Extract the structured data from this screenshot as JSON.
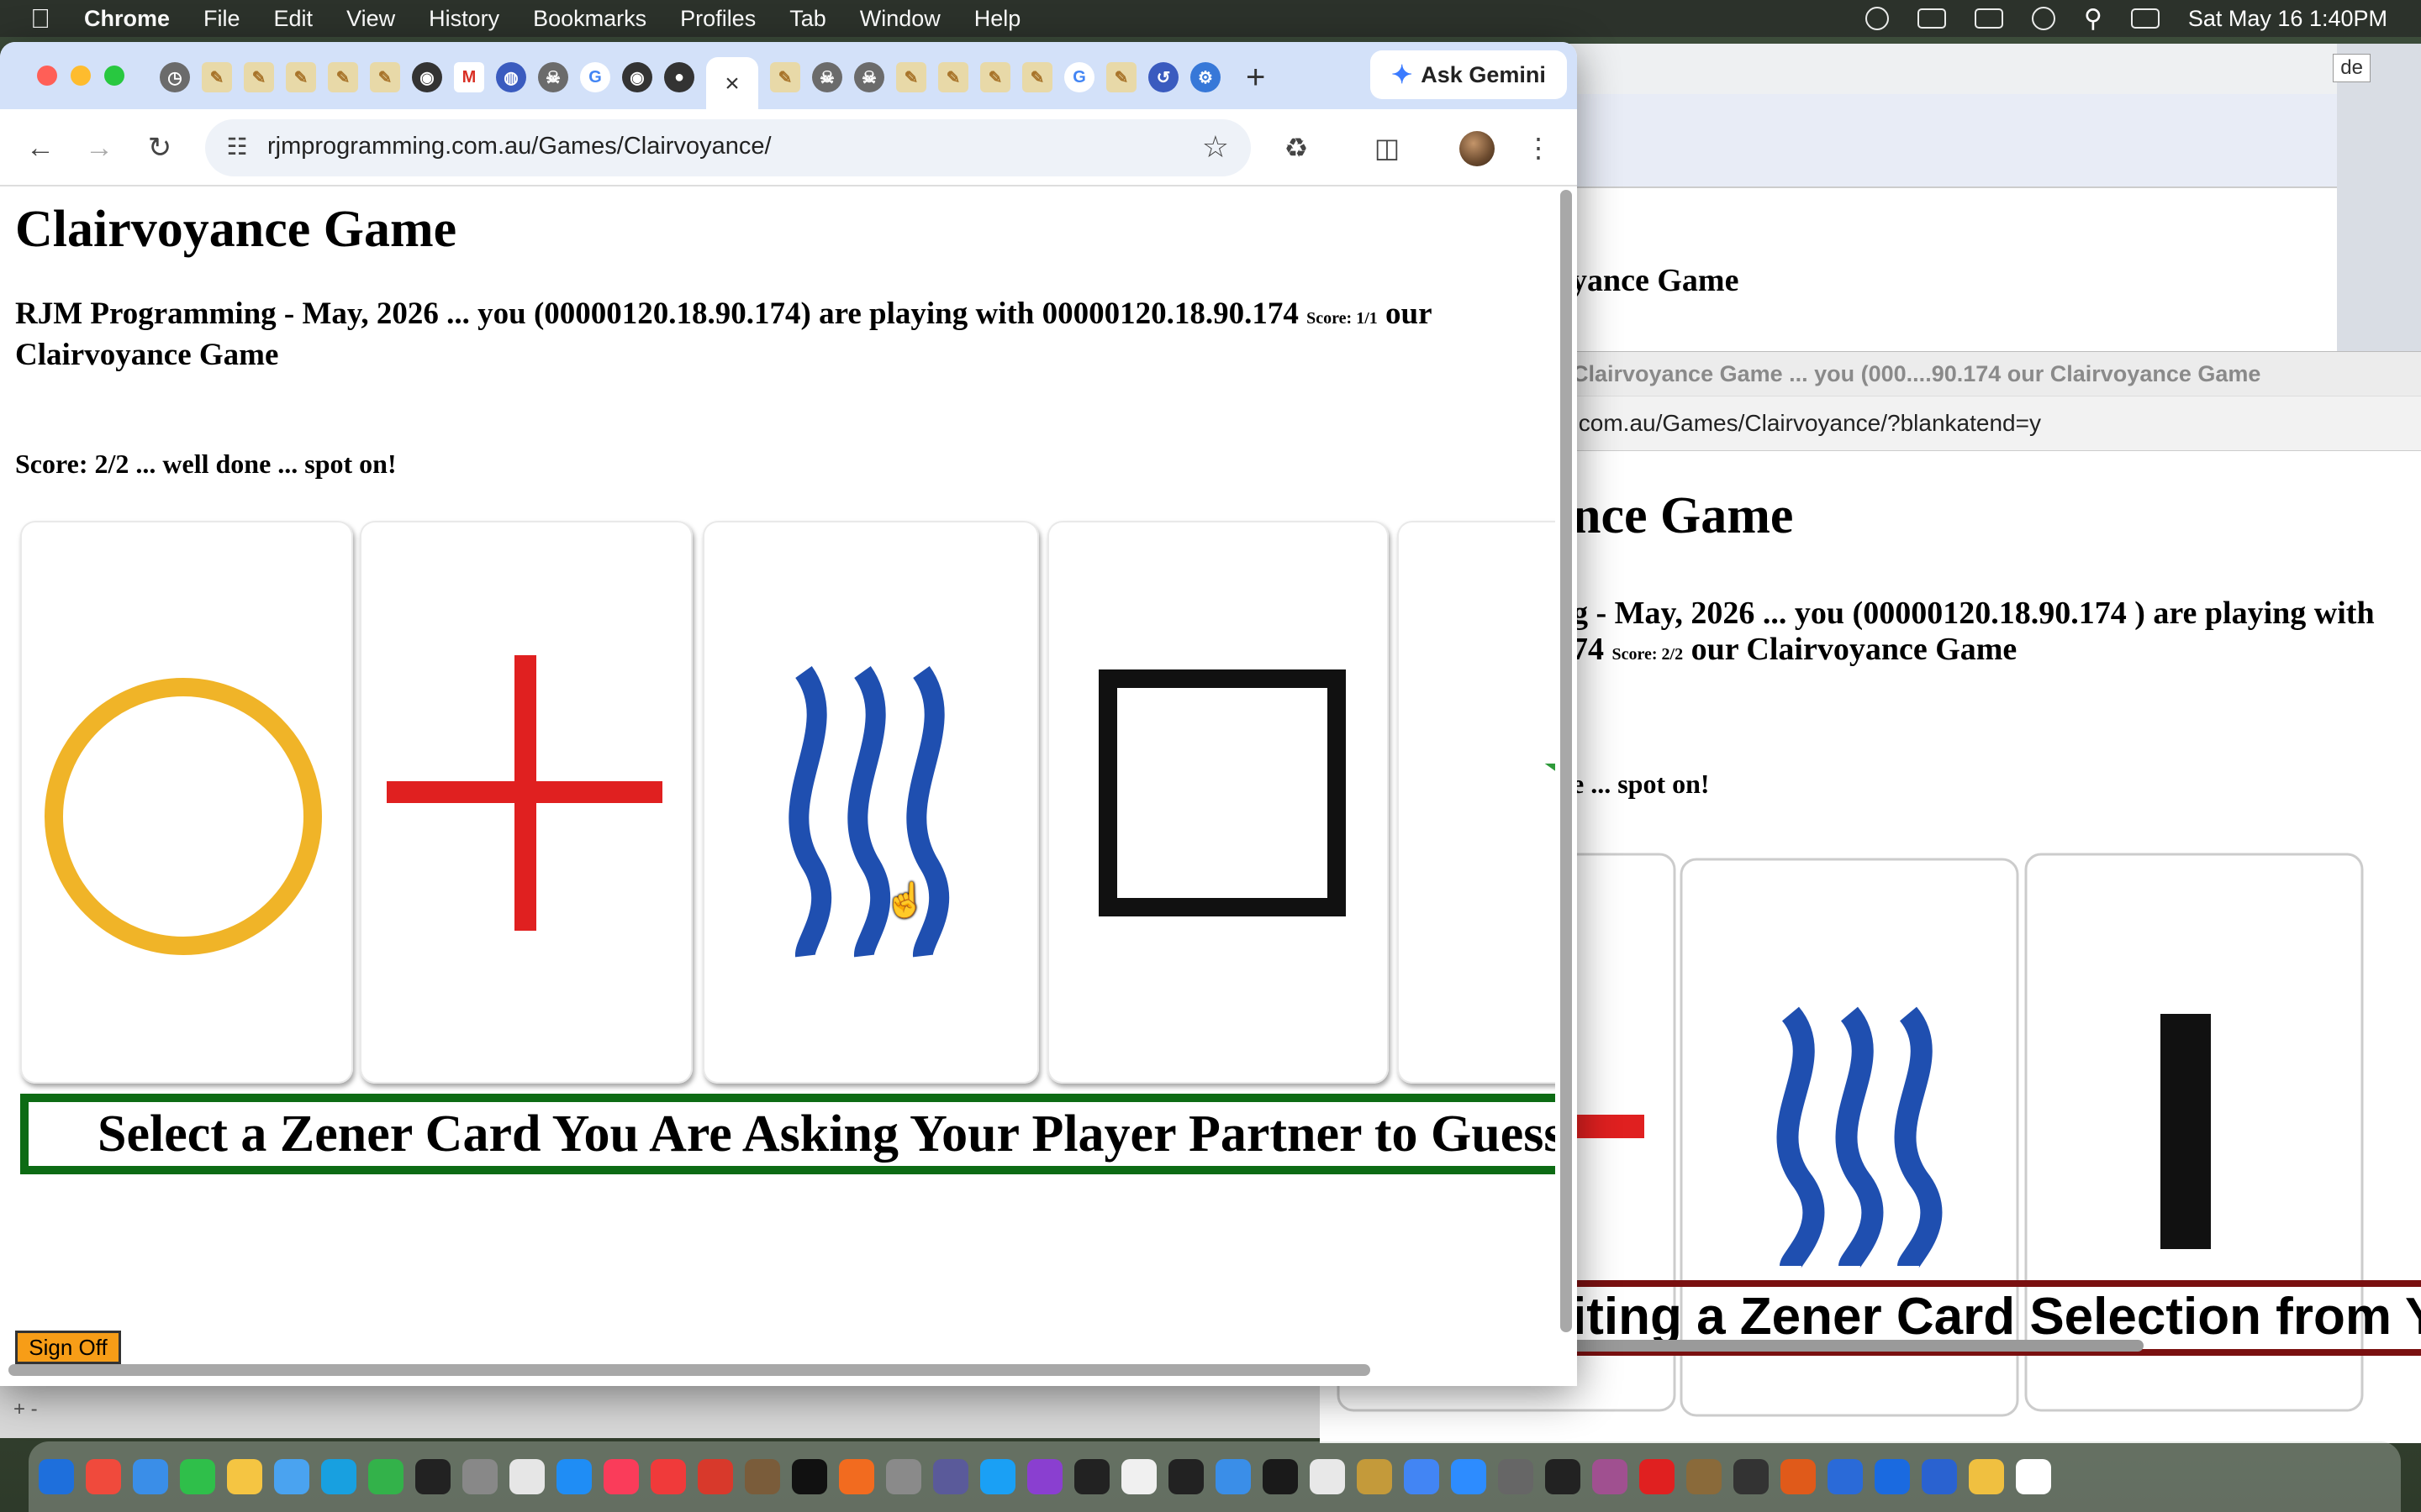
{
  "menubar": {
    "apple": "",
    "items": [
      "Chrome",
      "File",
      "Edit",
      "View",
      "History",
      "Bookmarks",
      "Profiles",
      "Tab",
      "Window",
      "Help"
    ],
    "clock": "Sat May 16  1:40PM"
  },
  "browser": {
    "active_tab_close": "×",
    "new_tab": "+",
    "gemini_label": "Ask Gemini",
    "url": "rjmprogramming.com.au/Games/Clairvoyance/",
    "tab_favicons": [
      "clock",
      "pen",
      "pen",
      "pen",
      "pen",
      "pen",
      "chrome",
      "gmail",
      "bluish",
      "skull",
      "google",
      "chrome",
      "dark",
      "active",
      "pen",
      "skull",
      "skull",
      "pen",
      "pen",
      "pen",
      "pen",
      "google",
      "pen",
      "history",
      "gear"
    ]
  },
  "page": {
    "title": "Clairvoyance Game",
    "subtitle_prefix": "RJM Programming - May, 2026 ... you (00000120.18.90.174) are playing with 00000120.18.90.174",
    "subtitle_score": "Score: 1/1",
    "subtitle_suffix": "our Clairvoyance Game",
    "score_line": "Score: 2/2 ... well done ... spot on!",
    "cards": [
      "circle",
      "cross",
      "waves",
      "square",
      "star"
    ],
    "banner": "Select a Zener Card You Are Asking Your Player Partner to Guess",
    "sign_off": "Sign Off"
  },
  "background_window": {
    "title_fragment": "oyance Game",
    "side_label": "de",
    "popup_title": "Clairvoyance Game ... you (000....90.174 our Clairvoyance Game",
    "popup_url": ".com.au/Games/Clairvoyance/?blankatend=y",
    "popup_h1": "nce Game",
    "popup_subtitle_a": "g - May, 2026 ... you (00000120.18.90.174 ) are playing with",
    "popup_subtitle_b": "74",
    "popup_subtitle_score": "Score: 2/2",
    "popup_subtitle_c": "our Clairvoyance Game",
    "popup_score_line": "e ... spot on!",
    "popup_banner": "iting a Zener Card Selection from Yo"
  },
  "finder": {
    "label": "+ -"
  },
  "dock": {
    "colors": [
      "#1e6fdc",
      "#f04a3c",
      "#3a8ee8",
      "#2fbf4a",
      "#f5c542",
      "#4aa3f0",
      "#18a0e0",
      "#33b24a",
      "#222222",
      "#888888",
      "#e6e6e6",
      "#1f8df5",
      "#fa3c5a",
      "#f03a3a",
      "#d8392b",
      "#7a5c3a",
      "#111111",
      "#f26b1f",
      "#8a8a8a",
      "#5a5a9a",
      "#1aa0f5",
      "#8a3fd0",
      "#222222",
      "#f0f0f0",
      "#222222",
      "#3a8ee8",
      "#1a1a1a",
      "#e8e8e8",
      "#c49a3a",
      "#4285f4",
      "#2d8cff",
      "#666666",
      "#222222",
      "#a05090",
      "#e02020",
      "#8a6a3a",
      "#333333",
      "#e05a1a",
      "#2a6ad8",
      "#1a6ae0",
      "#2a62d0",
      "#f0c040",
      "#ffffff"
    ]
  }
}
